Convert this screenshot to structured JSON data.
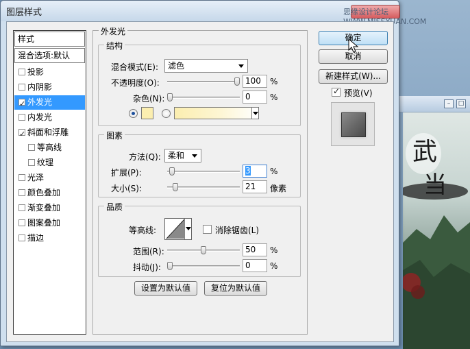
{
  "dialog": {
    "title": "图层样式",
    "watermark": "思缘设计论坛 WWW.MISSYUAN.COM"
  },
  "background_window": {
    "buttons": [
      "–",
      "□"
    ],
    "art_glyphs": [
      "武",
      "当"
    ]
  },
  "style_list": {
    "header": "样式",
    "blend_options": "混合选项:默认",
    "items": [
      {
        "label": "投影",
        "checked": false,
        "selected": false,
        "sub": false
      },
      {
        "label": "内阴影",
        "checked": false,
        "selected": false,
        "sub": false
      },
      {
        "label": "外发光",
        "checked": true,
        "selected": true,
        "sub": false
      },
      {
        "label": "内发光",
        "checked": false,
        "selected": false,
        "sub": false
      },
      {
        "label": "斜面和浮雕",
        "checked": true,
        "selected": false,
        "sub": false
      },
      {
        "label": "等高线",
        "checked": false,
        "selected": false,
        "sub": true
      },
      {
        "label": "纹理",
        "checked": false,
        "selected": false,
        "sub": true
      },
      {
        "label": "光泽",
        "checked": false,
        "selected": false,
        "sub": false
      },
      {
        "label": "颜色叠加",
        "checked": false,
        "selected": false,
        "sub": false
      },
      {
        "label": "渐变叠加",
        "checked": false,
        "selected": false,
        "sub": false
      },
      {
        "label": "图案叠加",
        "checked": false,
        "selected": false,
        "sub": false
      },
      {
        "label": "描边",
        "checked": false,
        "selected": false,
        "sub": false
      }
    ]
  },
  "outer_glow": {
    "title": "外发光",
    "structure": {
      "title": "结构",
      "blend_mode_label": "混合模式(E):",
      "blend_mode_value": "滤色",
      "opacity_label": "不透明度(O):",
      "opacity_value": "100",
      "opacity_unit": "%",
      "opacity_level": 1.0,
      "noise_label": "杂色(N):",
      "noise_value": "0",
      "noise_unit": "%",
      "noise_level": 0.0,
      "glow_color": "#fbeeb0"
    },
    "elements": {
      "title": "图素",
      "technique_label": "方法(Q):",
      "technique_value": "柔和",
      "spread_label": "扩展(P):",
      "spread_value": "3",
      "spread_unit": "%",
      "spread_level": 0.03,
      "size_label": "大小(S):",
      "size_value": "21",
      "size_unit": "像素",
      "size_level": 0.084
    },
    "quality": {
      "title": "品质",
      "contour_label": "等高线:",
      "anti_alias_label": "消除锯齿(L)",
      "anti_alias_checked": false,
      "range_label": "范围(R):",
      "range_value": "50",
      "range_unit": "%",
      "range_level": 0.5,
      "jitter_label": "抖动(J):",
      "jitter_value": "0",
      "jitter_unit": "%",
      "jitter_level": 0.0
    },
    "set_default": "设置为默认值",
    "reset_default": "复位为默认值"
  },
  "buttons": {
    "ok": "确定",
    "cancel": "取消",
    "new_style": "新建样式(W)...",
    "preview_label": "预览(V)",
    "preview_checked": true
  }
}
